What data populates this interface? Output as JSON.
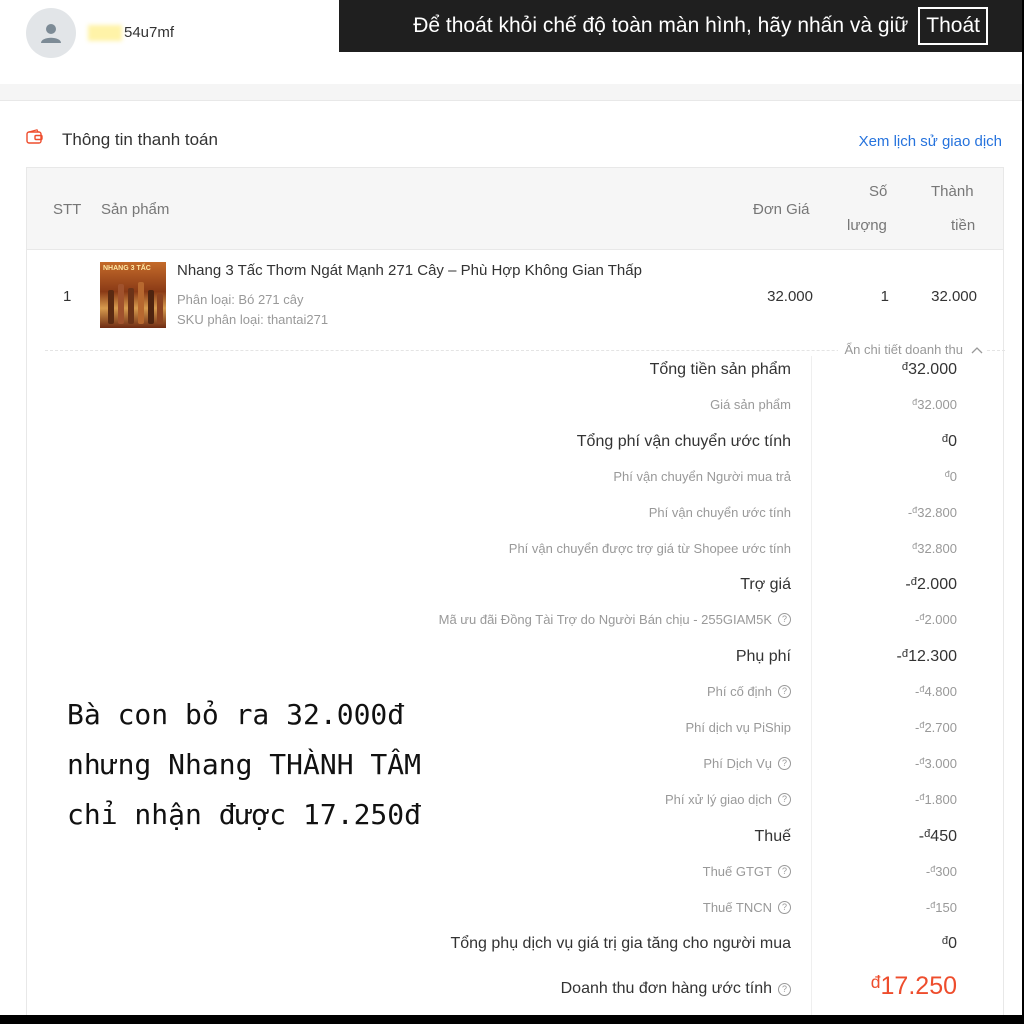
{
  "header": {
    "username": "54u7mf",
    "fullscreen_notice": "Để thoát khỏi chế độ toàn màn hình, hãy nhấn và giữ",
    "exit_label": "Thoát"
  },
  "section": {
    "title": "Thông tin thanh toán",
    "history_link": "Xem lịch sử giao dịch"
  },
  "table": {
    "columns": {
      "stt": "STT",
      "product": "Sản phẩm",
      "unit_price": "Đơn Giá",
      "qty_line1": "Số",
      "qty_line2": "lượng",
      "total_line1": "Thành",
      "total_line2": "tiền"
    },
    "rows": [
      {
        "stt": "1",
        "name": "Nhang 3 Tấc Thơm Ngát Mạnh 271 Cây – Phù Hợp Không Gian Thấp",
        "variant": "Phân loại: Bó 271 cây",
        "sku": "SKU phân loại: thantai271",
        "unit_price": "32.000",
        "qty": "1",
        "total": "32.000",
        "thumb_text": "NHANG 3 TẤC"
      }
    ]
  },
  "breakdown": {
    "toggle_label": "Ẩn chi tiết doanh thu",
    "currency": "đ",
    "lines": [
      {
        "label": "Tổng tiền sản phẩm",
        "sign": "",
        "amount": "32.000",
        "major": true,
        "help": false
      },
      {
        "label": "Giá sản phẩm",
        "sign": "",
        "amount": "32.000",
        "major": false,
        "help": false
      },
      {
        "label": "Tổng phí vận chuyển ước tính",
        "sign": "",
        "amount": "0",
        "major": true,
        "help": false
      },
      {
        "label": "Phí vận chuyển Người mua trả",
        "sign": "",
        "amount": "0",
        "major": false,
        "help": false
      },
      {
        "label": "Phí vận chuyển ước tính",
        "sign": "-",
        "amount": "32.800",
        "major": false,
        "help": false
      },
      {
        "label": "Phí vận chuyển được trợ giá từ Shopee ước tính",
        "sign": "",
        "amount": "32.800",
        "major": false,
        "help": false
      },
      {
        "label": "Trợ giá",
        "sign": "-",
        "amount": "2.000",
        "major": true,
        "help": false
      },
      {
        "label": "Mã ưu đãi Đồng Tài Trợ do Người Bán chịu - 255GIAM5K",
        "sign": "-",
        "amount": "2.000",
        "major": false,
        "help": true
      },
      {
        "label": "Phụ phí",
        "sign": "-",
        "amount": "12.300",
        "major": true,
        "help": false
      },
      {
        "label": "Phí cố định",
        "sign": "-",
        "amount": "4.800",
        "major": false,
        "help": true
      },
      {
        "label": "Phí dịch vụ PiShip",
        "sign": "-",
        "amount": "2.700",
        "major": false,
        "help": false
      },
      {
        "label": "Phí Dịch Vụ",
        "sign": "-",
        "amount": "3.000",
        "major": false,
        "help": true
      },
      {
        "label": "Phí xử lý giao dịch",
        "sign": "-",
        "amount": "1.800",
        "major": false,
        "help": true
      },
      {
        "label": "Thuế",
        "sign": "-",
        "amount": "450",
        "major": true,
        "help": false
      },
      {
        "label": "Thuế GTGT",
        "sign": "-",
        "amount": "300",
        "major": false,
        "help": true
      },
      {
        "label": "Thuế TNCN",
        "sign": "-",
        "amount": "150",
        "major": false,
        "help": true
      },
      {
        "label": "Tổng phụ dịch vụ giá trị gia tăng cho người mua",
        "sign": "",
        "amount": "0",
        "major": true,
        "help": false
      }
    ],
    "total": {
      "label": "Doanh thu đơn hàng ước tính",
      "sign": "",
      "amount": "17.250"
    }
  },
  "overlay_text": [
    "Bà con bỏ ra 32.000đ",
    "nhưng Nhang THÀNH TÂM",
    "chỉ nhận được 17.250đ"
  ],
  "colors": {
    "accent": "#ee4d2d",
    "link": "#2673dd",
    "banner": "#1f1f1f"
  },
  "icons": [
    "user-avatar-icon",
    "wallet-icon",
    "chevron-up-icon",
    "help-circle-icon"
  ]
}
